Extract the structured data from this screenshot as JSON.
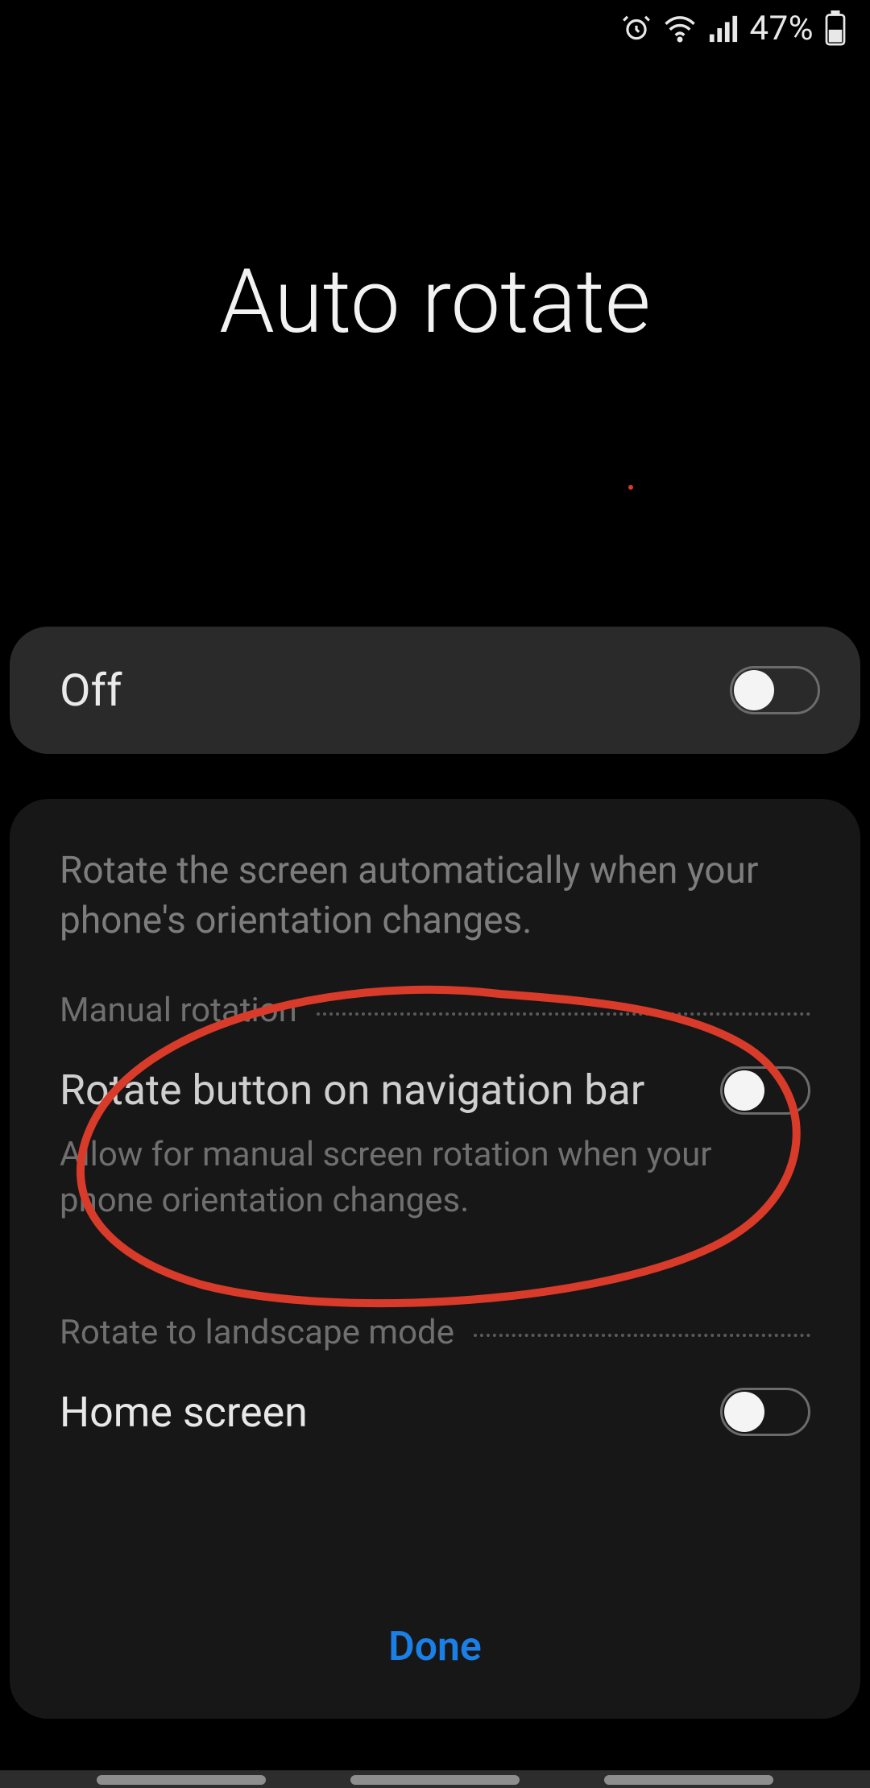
{
  "status": {
    "battery_pct": "47%"
  },
  "title": "Auto rotate",
  "main_toggle": {
    "label": "Off",
    "on": false
  },
  "description": "Rotate the screen automatically when your phone's orientation changes.",
  "section_manual": {
    "header": "Manual rotation",
    "item": {
      "label": "Rotate button on navigation bar",
      "description": "Allow for manual screen rotation when your phone orientation changes.",
      "on": false
    }
  },
  "section_landscape": {
    "header": "Rotate to landscape mode",
    "item": {
      "label": "Home screen",
      "on": false
    }
  },
  "done_label": "Done",
  "colors": {
    "accent": "#1a7fe6",
    "annotation": "#d83b2a"
  }
}
